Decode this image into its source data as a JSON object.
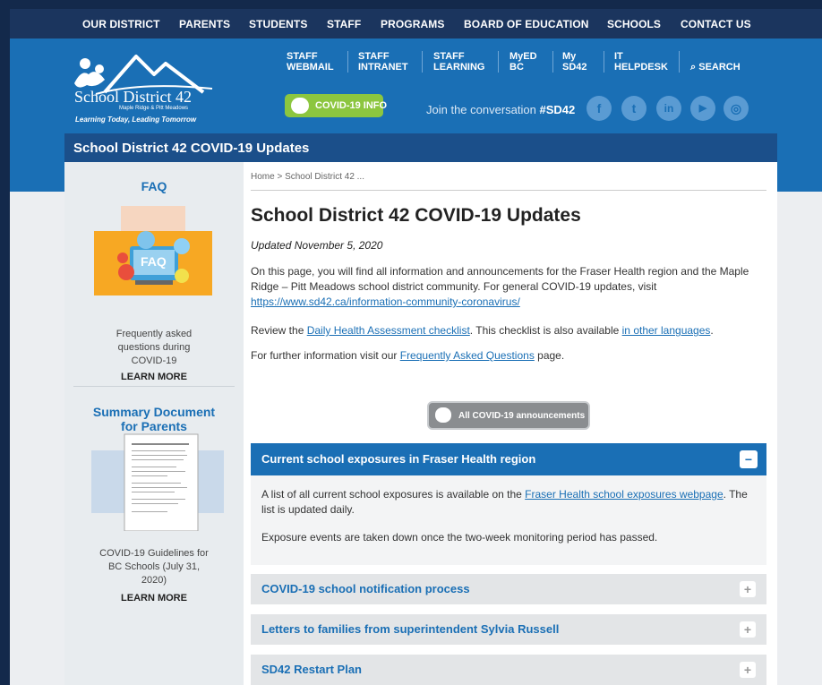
{
  "topnav": {
    "items": [
      "OUR DISTRICT",
      "PARENTS",
      "STUDENTS",
      "STAFF",
      "PROGRAMS",
      "BOARD OF EDUCATION",
      "SCHOOLS",
      "CONTACT US"
    ]
  },
  "header": {
    "logo_name": "School District 42",
    "logo_sub": "Maple Ridge & Pitt Meadows",
    "logo_tagline": "Learning Today, Leading Tomorrow",
    "quick_links": [
      {
        "line1": "STAFF",
        "line2": "WEBMAIL"
      },
      {
        "line1": "STAFF",
        "line2": "INTRANET"
      },
      {
        "line1": "STAFF",
        "line2": "LEARNING"
      },
      {
        "line1": "MyED",
        "line2": "BC"
      },
      {
        "line1": "My",
        "line2": "SD42"
      },
      {
        "line1": "IT",
        "line2": "HELPDESK"
      }
    ],
    "search_label": "SEARCH",
    "covid_button": "COVID-19 INFO",
    "join_text": "Join the conversation",
    "hashtag": "#SD42",
    "social": [
      "facebook-icon",
      "twitter-icon",
      "linkedin-icon",
      "youtube-icon",
      "instagram-icon"
    ],
    "social_glyphs": [
      "f",
      "t",
      "in",
      "▶",
      "◎"
    ]
  },
  "titlebar": {
    "title": "School District 42 COVID-19 Updates"
  },
  "sidebar": {
    "faq_heading": "FAQ",
    "faq_img_label": "FAQ",
    "faq_text": "Frequently asked questions during COVID-19",
    "faq_learn_more": "LEARN MORE",
    "summary_heading": "Summary Document for Parents",
    "summary_text": "COVID-19 Guidelines for BC Schools (July 31, 2020)",
    "summary_learn_more": "LEARN MORE"
  },
  "main": {
    "breadcrumb": "Home > School District 42 ...",
    "title": "School District 42 COVID-19 Updates",
    "updated": "Updated November 5, 2020",
    "intro_text": "On this page, you will find all information and announcements for the Fraser Health region and the Maple Ridge – Pitt Meadows school district community. For general COVID-19 updates, visit ",
    "intro_link": "https://www.sd42.ca/information-community-coronavirus/",
    "review_pre": "Review the ",
    "review_link": "Daily Health Assessment checklist",
    "review_mid": ". This checklist is also available ",
    "review_link2": "in other languages",
    "review_post": ".",
    "further_pre": "For further information visit our ",
    "further_link": "Frequently Asked Questions",
    "further_post": " page.",
    "announcements_button": "All COVID-19 announcements",
    "accordion_open": {
      "title": "Current school exposures in Fraser Health region",
      "p1_pre": "A list of all current school exposures is available on the ",
      "p1_link": "Fraser Health school exposures webpage",
      "p1_post": ". The list is updated daily.",
      "p2": "Exposure events are taken down once the two-week monitoring period has passed."
    },
    "accordions": [
      {
        "title": "COVID-19 school notification process"
      },
      {
        "title": "Letters to families from superintendent Sylvia Russell"
      },
      {
        "title": "SD42 Restart Plan"
      }
    ]
  },
  "colors": {
    "nav": "#1b355e",
    "header": "#1a6fb5",
    "accent_green": "#8cc63f"
  }
}
